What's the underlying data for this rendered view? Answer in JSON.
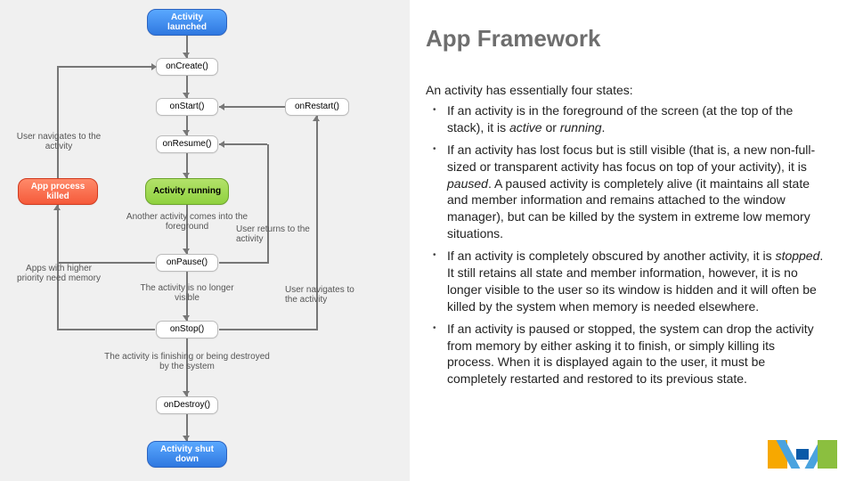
{
  "title": "App Framework",
  "intro": "An activity has essentially four states:",
  "bullets": [
    {
      "pre": "If an activity is in the foreground of the screen (at the top of the stack), it is ",
      "em1": "active",
      "mid": " or ",
      "em2": "running",
      "post": "."
    },
    {
      "pre": "If an activity has lost focus but is still visible (that is, a new non-full-sized or transparent activity has focus on top of your activity), it is ",
      "em1": "paused",
      "mid": "",
      "em2": "",
      "post": ". A paused activity is completely alive (it maintains all state and member information and remains attached to the window manager), but can be killed by the system in extreme low memory situations."
    },
    {
      "pre": "If an activity is completely obscured by another activity, it is ",
      "em1": "stopped",
      "mid": "",
      "em2": "",
      "post": ". It still retains all state and member information, however, it is no longer visible to the user so its window is hidden and it will often be killed by the system when memory is needed elsewhere."
    },
    {
      "pre": "If an activity is paused or stopped, the system can drop the activity from memory by either asking it to finish, or simply killing its process. When it is displayed again to the user, it must be completely restarted and restored to its previous state.",
      "em1": "",
      "mid": "",
      "em2": "",
      "post": ""
    }
  ],
  "diagram": {
    "launched": "Activity launched",
    "onCreate": "onCreate()",
    "onStart": "onStart()",
    "onRestart": "onRestart()",
    "onResume": "onResume()",
    "running": "Activity running",
    "onPause": "onPause()",
    "onStop": "onStop()",
    "onDestroy": "onDestroy()",
    "shutdown": "Activity shut down",
    "processKilled": "App process killed",
    "lblNavTo": "User navigates to the activity",
    "lblAnother": "Another activity comes into the foreground",
    "lblReturns": "User returns to the activity",
    "lblNoLonger": "The activity is no longer visible",
    "lblNavBack": "User navigates to the activity",
    "lblFinishing": "The activity is finishing or being destroyed by the system",
    "lblHigherPri": "Apps with higher priority need memory"
  }
}
